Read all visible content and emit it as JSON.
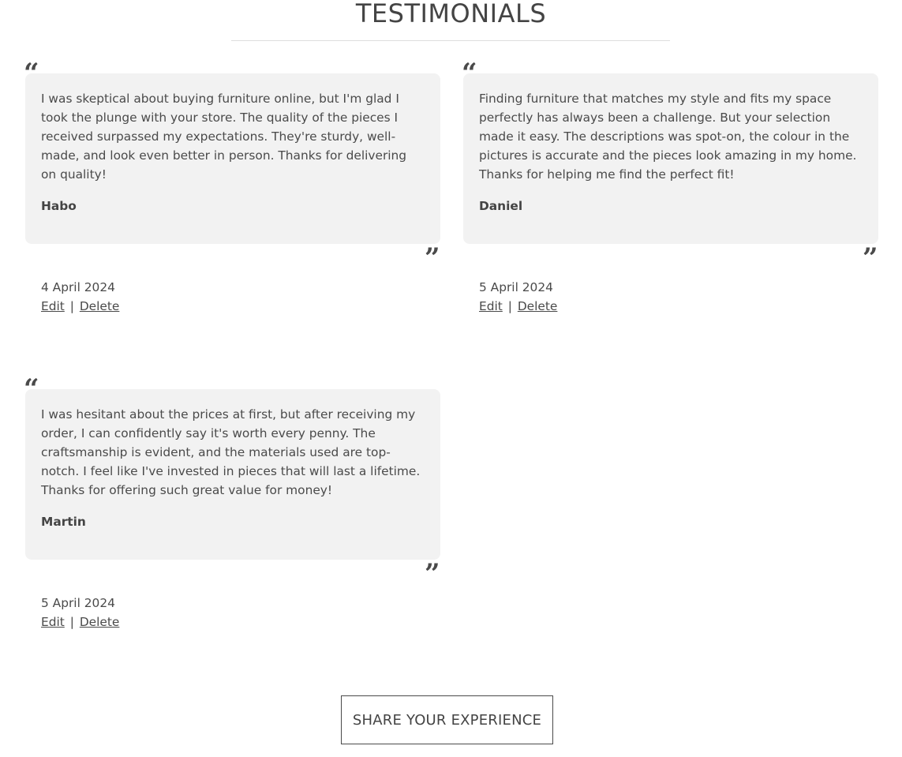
{
  "page": {
    "title": "TESTIMONIALS"
  },
  "testimonials": [
    {
      "text": "I was skeptical about buying furniture online, but I'm glad I took the plunge with your store. The quality of the pieces I received surpassed my expectations. They're sturdy, well-made, and look even better in person. Thanks for delivering on quality!",
      "author": "Habo",
      "date": "4 April 2024",
      "edit_label": "Edit",
      "delete_label": "Delete",
      "separator": "|"
    },
    {
      "text": "Finding furniture that matches my style and fits my space perfectly has always been a challenge. But your selection made it easy. The descriptions was spot-on, the colour in the pictures is accurate and the pieces look amazing in my home. Thanks for helping me find the perfect fit!",
      "author": "Daniel",
      "date": "5 April 2024",
      "edit_label": "Edit",
      "delete_label": "Delete",
      "separator": "|"
    },
    {
      "text": "I was hesitant about the prices at first, but after receiving my order, I can confidently say it's worth every penny. The craftsmanship is evident, and the materials used are top-notch. I feel like I've invested in pieces that will last a lifetime. Thanks for offering such great value for money!",
      "author": "Martin",
      "date": "5 April 2024",
      "edit_label": "Edit",
      "delete_label": "Delete",
      "separator": "|"
    }
  ],
  "icons": {
    "quote_open": "“",
    "quote_close": "”",
    "quote_open_icon": "quote-open-icon",
    "quote_close_icon": "quote-close-icon"
  },
  "actions": {
    "share_label": "SHARE YOUR EXPERIENCE"
  },
  "colors": {
    "card_background": "#f2f2f2",
    "text": "#4a4a4a"
  }
}
